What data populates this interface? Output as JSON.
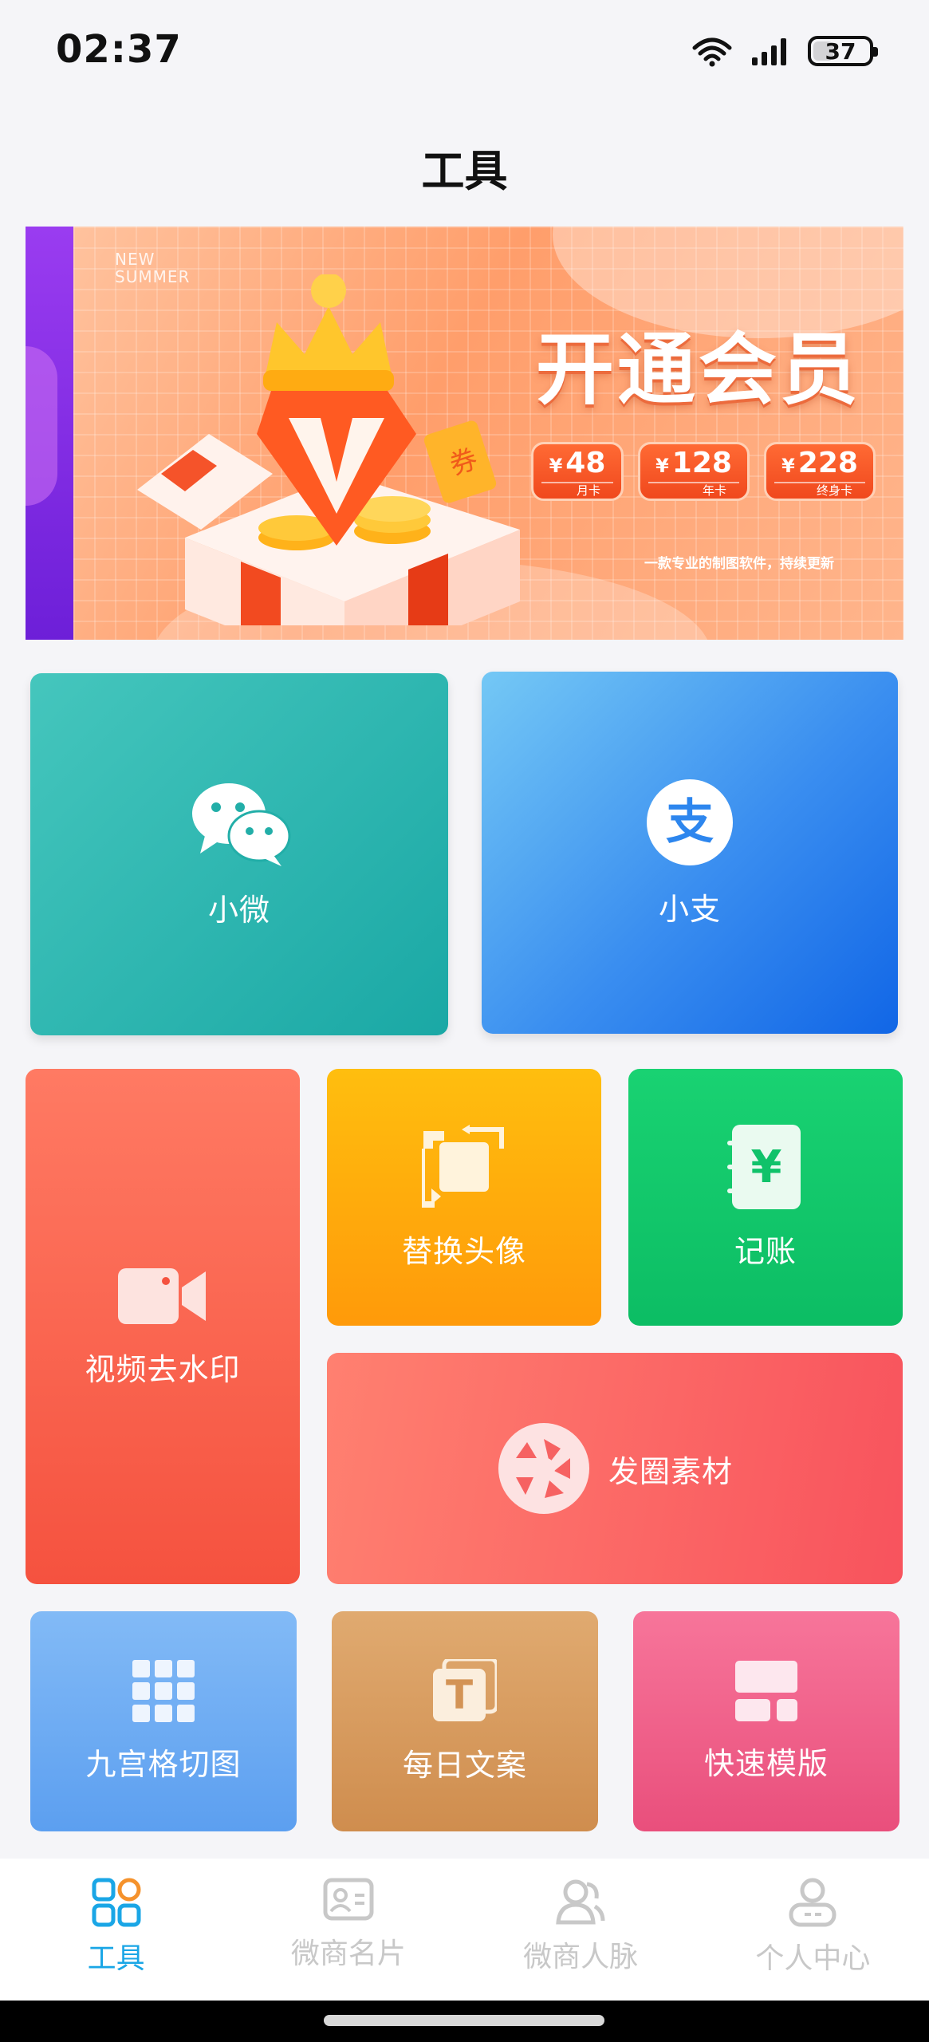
{
  "status_bar": {
    "time": "02:37",
    "battery": "37"
  },
  "page_title": "工具",
  "banner": {
    "tagline": "NEW SUMMER",
    "headline": "开通会员",
    "prices": [
      {
        "amount": "48",
        "currency": "¥",
        "label": "月卡"
      },
      {
        "amount": "128",
        "currency": "¥",
        "label": "年卡"
      },
      {
        "amount": "228",
        "currency": "¥",
        "label": "终身卡"
      }
    ],
    "subtitle": "一款专业的制图软件，持续更新",
    "coupon_text": "券"
  },
  "tiles": {
    "wechat": {
      "label": "小微",
      "icon": "wechat-icon"
    },
    "alipay": {
      "label": "小支",
      "icon": "alipay-icon",
      "glyph": "支"
    },
    "video": {
      "label": "视频去水印",
      "icon": "video-camera-icon"
    },
    "swap": {
      "label": "替换头像",
      "icon": "swap-icon"
    },
    "accounting": {
      "label": "记账",
      "icon": "ledger-icon",
      "glyph": "¥"
    },
    "circle": {
      "label": "发圈素材",
      "icon": "shutter-icon"
    },
    "grid": {
      "label": "九宫格切图",
      "icon": "grid-icon"
    },
    "copy": {
      "label": "每日文案",
      "icon": "text-icon",
      "glyph": "T"
    },
    "template": {
      "label": "快速模版",
      "icon": "template-icon"
    }
  },
  "tabbar": {
    "items": [
      {
        "label": "工具",
        "icon": "tools-icon",
        "active": true
      },
      {
        "label": "微商名片",
        "icon": "card-icon",
        "active": false
      },
      {
        "label": "微商人脉",
        "icon": "contacts-icon",
        "active": false
      },
      {
        "label": "个人中心",
        "icon": "profile-icon",
        "active": false
      }
    ]
  },
  "colors": {
    "accent": "#1aa6e6",
    "inactive": "#c8c8c8"
  }
}
